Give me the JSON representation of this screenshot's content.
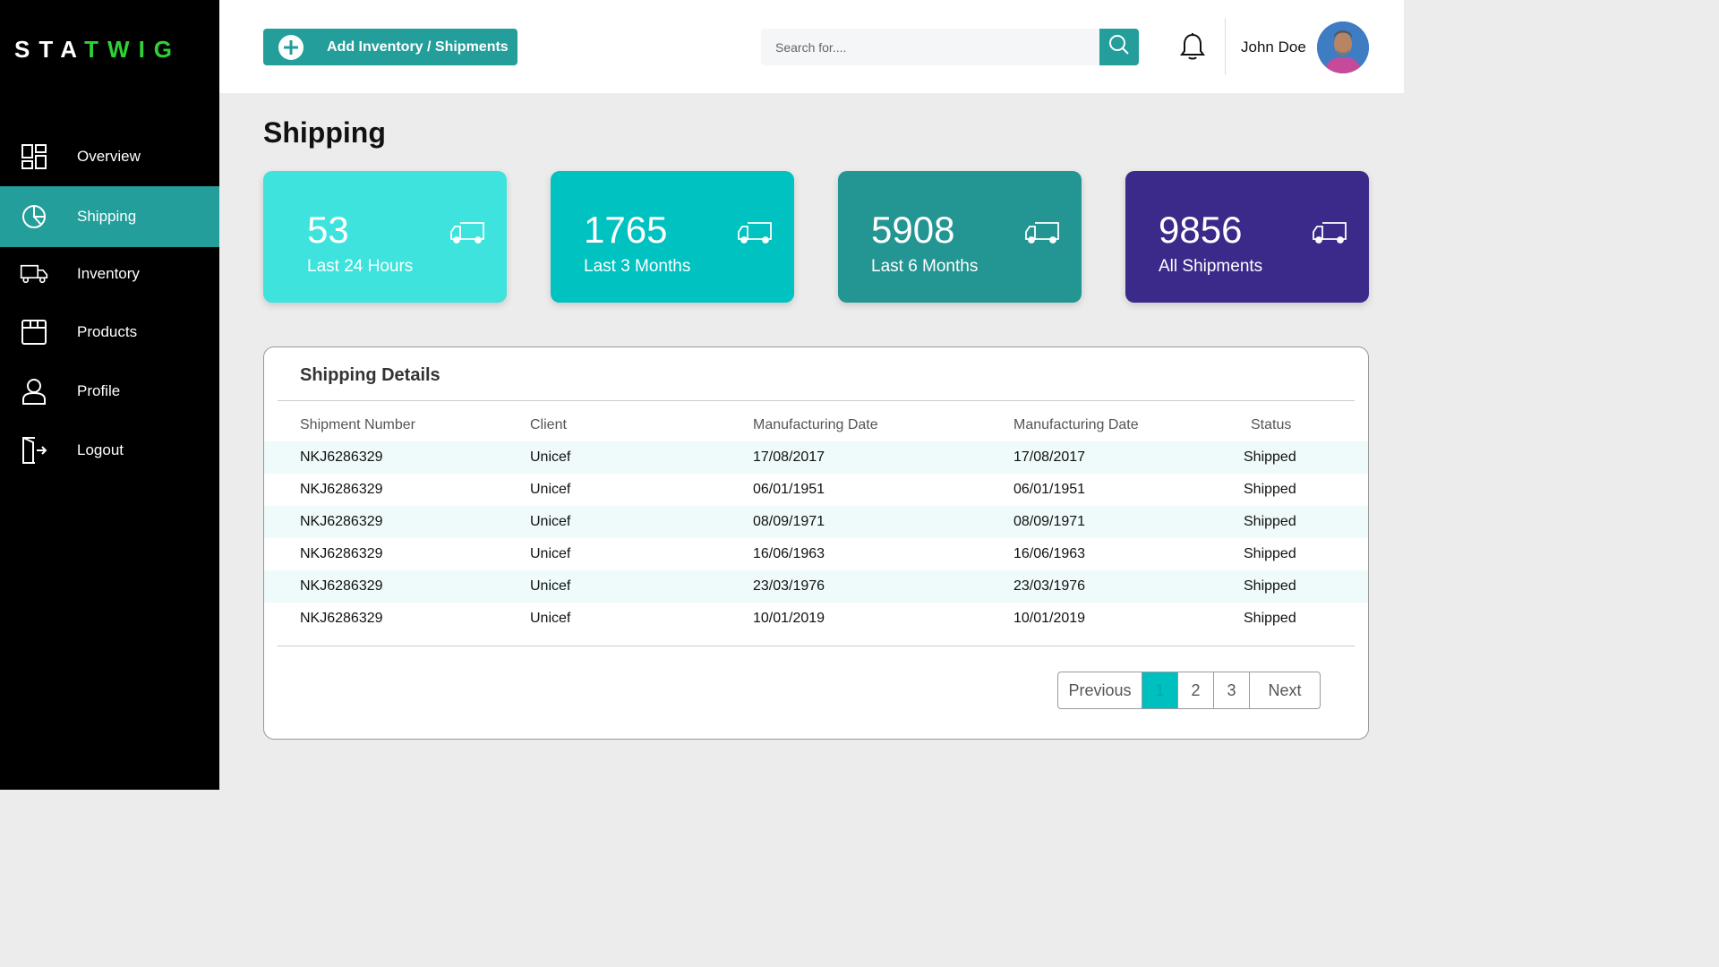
{
  "brand": {
    "part1": "STA",
    "part2": "TWIG"
  },
  "sidebar": {
    "items": [
      {
        "label": "Overview",
        "icon": "grid-icon"
      },
      {
        "label": "Shipping",
        "icon": "pie-chart-icon"
      },
      {
        "label": "Inventory",
        "icon": "truck-icon"
      },
      {
        "label": "Products",
        "icon": "box-icon"
      },
      {
        "label": "Profile",
        "icon": "user-icon"
      },
      {
        "label": "Logout",
        "icon": "logout-icon"
      }
    ],
    "active": "Shipping"
  },
  "header": {
    "add_button": "Add Inventory / Shipments",
    "search_placeholder": "Search for....",
    "user_name": "John Doe"
  },
  "page_title": "Shipping",
  "stats": [
    {
      "value": "53",
      "label": "Last 24 Hours",
      "color": "#3de3dc"
    },
    {
      "value": "1765",
      "label": "Last 3 Months",
      "color": "#00c2c0"
    },
    {
      "value": "5908",
      "label": "Last 6 Months",
      "color": "#239593"
    },
    {
      "value": "9856",
      "label": "All Shipments",
      "color": "#3b2a8a"
    }
  ],
  "details": {
    "title": "Shipping Details",
    "columns": [
      "Shipment Number",
      "Client",
      "Manufacturing Date",
      "Manufacturing Date",
      "Status"
    ],
    "rows": [
      [
        "NKJ6286329",
        "Unicef",
        "17/08/2017",
        "17/08/2017",
        "Shipped"
      ],
      [
        "NKJ6286329",
        "Unicef",
        "06/01/1951",
        "06/01/1951",
        "Shipped"
      ],
      [
        "NKJ6286329",
        "Unicef",
        "08/09/1971",
        "08/09/1971",
        "Shipped"
      ],
      [
        "NKJ6286329",
        "Unicef",
        "16/06/1963",
        "16/06/1963",
        "Shipped"
      ],
      [
        "NKJ6286329",
        "Unicef",
        "23/03/1976",
        "23/03/1976",
        "Shipped"
      ],
      [
        "NKJ6286329",
        "Unicef",
        "10/01/2019",
        "10/01/2019",
        "Shipped"
      ]
    ]
  },
  "pagination": {
    "prev": "Previous",
    "pages": [
      "1",
      "2",
      "3"
    ],
    "current": "1",
    "next": "Next"
  }
}
